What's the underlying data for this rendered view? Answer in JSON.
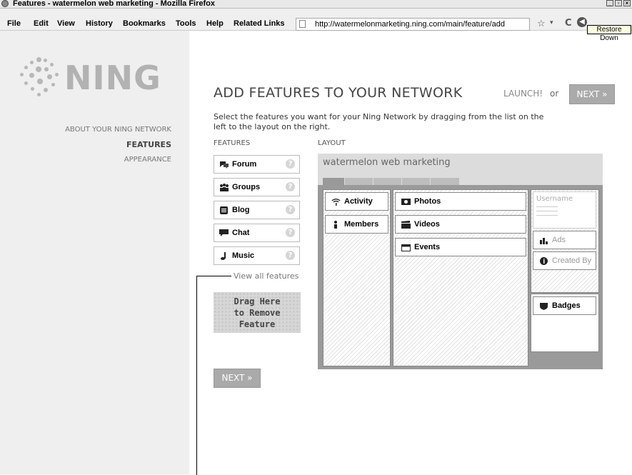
{
  "window": {
    "title": "Features - watermelon web marketing - Mozilla Firefox",
    "tooltip": "Restore Down"
  },
  "menu": {
    "items": [
      "File",
      "Edit",
      "View",
      "History",
      "Bookmarks",
      "Tools",
      "Help",
      "Related Links"
    ]
  },
  "url_bar": {
    "url": "http://watermelonmarketing.ning.com/main/feature/add"
  },
  "sidebar": {
    "logo_text": "NING",
    "items": [
      {
        "label": "ABOUT YOUR NING NETWORK",
        "active": false
      },
      {
        "label": "FEATURES",
        "active": true
      },
      {
        "label": "APPEARANCE",
        "active": false
      }
    ]
  },
  "main": {
    "heading": "ADD FEATURES TO YOUR NETWORK",
    "launch_label": "LAUNCH!",
    "or_label": "or",
    "next_label": "NEXT »",
    "instructions": "Select the features you want for your Ning Network by dragging from the list on the left to the layout on the right.",
    "features_label": "FEATURES",
    "layout_label": "LAYOUT",
    "view_all": "View all features",
    "drag_remove": "Drag Here to Remove Feature",
    "bottom_next_label": "NEXT »"
  },
  "features": [
    {
      "label": "Forum",
      "icon": "forum-icon",
      "help": "?"
    },
    {
      "label": "Groups",
      "icon": "groups-icon",
      "help": "?"
    },
    {
      "label": "Blog",
      "icon": "blog-icon",
      "help": "?"
    },
    {
      "label": "Chat",
      "icon": "chat-icon",
      "help": "?"
    },
    {
      "label": "Music",
      "icon": "music-icon",
      "help": "?"
    }
  ],
  "layout": {
    "site_name": "watermelon web marketing",
    "left_column": [
      {
        "label": "Activity",
        "icon": "activity-icon"
      },
      {
        "label": "Members",
        "icon": "members-icon"
      }
    ],
    "middle_column": [
      {
        "label": "Photos",
        "icon": "photos-icon"
      },
      {
        "label": "Videos",
        "icon": "videos-icon"
      },
      {
        "label": "Events",
        "icon": "events-icon"
      }
    ],
    "right_column": {
      "username": "Username",
      "ads": "Ads",
      "created_by": "Created By",
      "badges": "Badges"
    }
  }
}
